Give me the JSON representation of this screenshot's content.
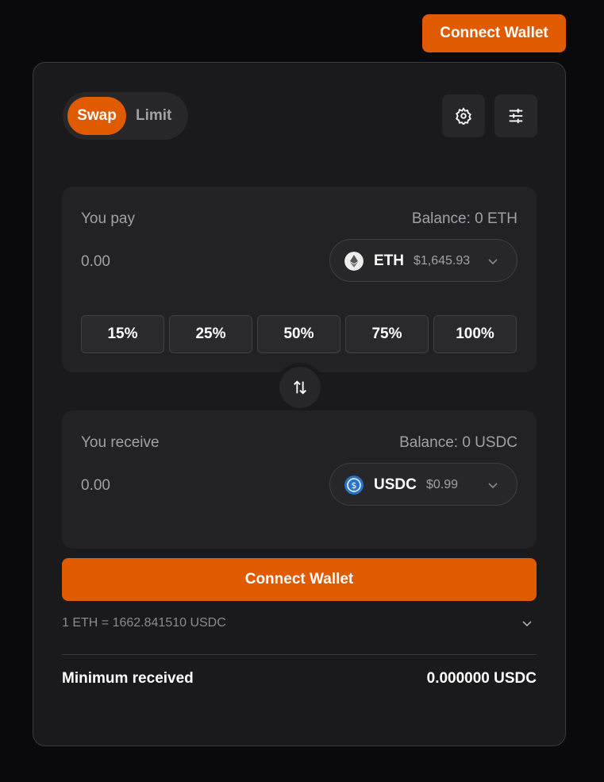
{
  "header": {
    "connect_label": "Connect Wallet"
  },
  "tabs": [
    {
      "label": "Swap",
      "active": true
    },
    {
      "label": "Limit",
      "active": false
    }
  ],
  "icons": {
    "settings": "gear-icon",
    "filters": "sliders-icon",
    "flip": "swap-vertical-icon"
  },
  "pay": {
    "label": "You pay",
    "balance": "Balance: 0 ETH",
    "amount": "0.00",
    "token": {
      "symbol": "ETH",
      "price": "$1,645.93",
      "icon": "ethereum-icon"
    },
    "percent_buttons": [
      "15%",
      "25%",
      "50%",
      "75%",
      "100%"
    ]
  },
  "receive": {
    "label": "You receive",
    "balance": "Balance: 0 USDC",
    "amount": "0.00",
    "token": {
      "symbol": "USDC",
      "price": "$0.99",
      "icon": "usdc-icon"
    }
  },
  "action": {
    "label": "Connect Wallet"
  },
  "rate": "1 ETH = 1662.841510 USDC",
  "minimum": {
    "label": "Minimum received",
    "value": "0.000000 USDC"
  },
  "colors": {
    "accent": "#e05a00",
    "background": "#0a0a0c",
    "card": "#1a1a1c",
    "panel": "#222225"
  }
}
